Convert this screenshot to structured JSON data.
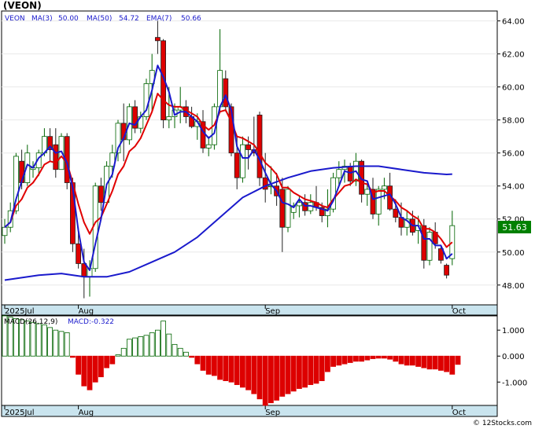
{
  "header": {
    "title": "(VEON)"
  },
  "legend": {
    "ticker": "VEON",
    "ma3": "MA(3)",
    "ma3_value": "50.00",
    "ma50": "MA(50)",
    "ma50_value": "54.72",
    "ema7": "EMA(7)",
    "ema7_value": "50.66"
  },
  "price_badge": "51.63",
  "macd_legend": {
    "label": "MACD(26,12,9)",
    "value": "MACD:-0.322"
  },
  "watermark": "© 12Stocks.com",
  "colors": {
    "up": "#006400",
    "down": "#dd0000",
    "ma3": "#1a1acc",
    "ma50": "#1a1acc",
    "ema7": "#e00000",
    "axis_band": "#c9e4ee",
    "badge": "#008000",
    "legend_text": "#1a1acc"
  },
  "chart_data": [
    {
      "type": "candlestick",
      "title": "",
      "x_labels": [
        "2025Jul",
        "Aug",
        "Sep",
        "Oct"
      ],
      "x_label_index": [
        0,
        13,
        46,
        79
      ],
      "y_ticks": [
        "48.00",
        "50.00",
        "52.00",
        "54.00",
        "56.00",
        "58.00",
        "60.00",
        "62.00",
        "64.00"
      ],
      "ylim": [
        46.8,
        64.6
      ],
      "candles": [
        [
          51.0,
          52.0,
          50.5,
          51.5
        ],
        [
          51.5,
          53.0,
          51.2,
          52.5
        ],
        [
          52.5,
          56.0,
          52.3,
          55.8
        ],
        [
          55.5,
          56.2,
          53.8,
          54.2
        ],
        [
          54.2,
          56.5,
          54.0,
          56.0
        ],
        [
          55.0,
          55.5,
          54.5,
          55.1
        ],
        [
          55.1,
          56.2,
          54.6,
          56.0
        ],
        [
          56.0,
          57.5,
          55.8,
          57.0
        ],
        [
          57.0,
          57.5,
          55.5,
          56.2
        ],
        [
          56.5,
          57.5,
          54.5,
          55.0
        ],
        [
          55.0,
          57.2,
          55.0,
          57.0
        ],
        [
          57.0,
          57.2,
          53.8,
          54.2
        ],
        [
          54.2,
          54.5,
          50.0,
          50.5
        ],
        [
          50.5,
          51.5,
          49.0,
          49.3
        ],
        [
          49.3,
          50.2,
          47.2,
          48.5
        ],
        [
          48.5,
          49.5,
          47.3,
          49.0
        ],
        [
          49.0,
          54.2,
          48.8,
          54.0
        ],
        [
          54.0,
          54.5,
          52.5,
          53.0
        ],
        [
          53.0,
          55.5,
          53.0,
          55.2
        ],
        [
          55.2,
          56.5,
          54.5,
          56.0
        ],
        [
          56.0,
          58.0,
          55.5,
          57.8
        ],
        [
          57.8,
          59.0,
          55.5,
          56.8
        ],
        [
          56.8,
          59.0,
          56.5,
          58.8
        ],
        [
          58.8,
          59.2,
          57.2,
          57.5
        ],
        [
          57.5,
          58.5,
          57.2,
          58.2
        ],
        [
          58.2,
          60.5,
          58.0,
          60.2
        ],
        [
          60.2,
          62.0,
          58.5,
          61.0
        ],
        [
          63.0,
          64.0,
          62.0,
          62.8
        ],
        [
          62.8,
          62.9,
          57.5,
          58.0
        ],
        [
          58.0,
          60.0,
          57.5,
          58.2
        ],
        [
          58.2,
          59.0,
          57.5,
          58.6
        ],
        [
          58.6,
          60.0,
          57.8,
          58.8
        ],
        [
          58.8,
          59.2,
          57.8,
          58.2
        ],
        [
          58.2,
          58.8,
          57.5,
          57.6
        ],
        [
          57.6,
          58.4,
          56.8,
          57.9
        ],
        [
          57.9,
          58.6,
          56.0,
          56.3
        ],
        [
          56.3,
          57.0,
          55.8,
          56.5
        ],
        [
          56.5,
          59.0,
          56.2,
          58.8
        ],
        [
          58.8,
          63.5,
          58.5,
          61.0
        ],
        [
          60.5,
          61.0,
          58.5,
          58.8
        ],
        [
          58.8,
          59.0,
          55.8,
          56.0
        ],
        [
          56.0,
          57.0,
          53.8,
          54.5
        ],
        [
          54.5,
          57.0,
          54.2,
          56.5
        ],
        [
          56.5,
          57.0,
          55.0,
          56.2
        ],
        [
          56.2,
          58.2,
          55.8,
          56.0
        ],
        [
          58.3,
          58.5,
          54.0,
          54.5
        ],
        [
          54.5,
          56.0,
          53.0,
          53.8
        ],
        [
          54.0,
          55.2,
          53.5,
          54.0
        ],
        [
          54.0,
          54.8,
          52.8,
          53.4
        ],
        [
          53.8,
          54.5,
          50.0,
          51.5
        ],
        [
          51.5,
          54.0,
          51.2,
          53.8
        ],
        [
          52.4,
          53.0,
          52.0,
          52.8
        ],
        [
          52.8,
          53.4,
          52.1,
          53.0
        ],
        [
          53.0,
          53.5,
          52.2,
          52.5
        ],
        [
          52.5,
          53.5,
          52.3,
          53.0
        ],
        [
          53.0,
          54.0,
          52.5,
          52.7
        ],
        [
          52.7,
          53.0,
          51.8,
          52.2
        ],
        [
          52.2,
          53.8,
          51.5,
          52.6
        ],
        [
          52.6,
          54.8,
          52.4,
          54.5
        ],
        [
          54.5,
          55.5,
          54.0,
          55.0
        ],
        [
          55.0,
          55.6,
          54.2,
          55.2
        ],
        [
          55.2,
          55.4,
          54.0,
          54.3
        ],
        [
          54.3,
          56.0,
          54.0,
          55.5
        ],
        [
          55.5,
          55.6,
          53.0,
          53.5
        ],
        [
          53.5,
          54.2,
          52.8,
          53.8
        ],
        [
          53.8,
          54.5,
          52.0,
          52.3
        ],
        [
          52.3,
          54.0,
          51.6,
          53.8
        ],
        [
          53.8,
          54.5,
          53.2,
          54.0
        ],
        [
          54.0,
          54.8,
          52.5,
          52.6
        ],
        [
          52.6,
          53.2,
          51.8,
          52.1
        ],
        [
          52.1,
          53.0,
          51.0,
          51.5
        ],
        [
          51.5,
          52.5,
          51.0,
          52.0
        ],
        [
          52.0,
          52.5,
          51.0,
          51.2
        ],
        [
          51.3,
          52.2,
          50.5,
          51.6
        ],
        [
          51.6,
          52.0,
          49.0,
          49.5
        ],
        [
          49.5,
          51.5,
          49.2,
          51.2
        ],
        [
          51.2,
          51.8,
          50.2,
          50.5
        ],
        [
          50.2,
          50.4,
          49.3,
          49.5
        ],
        [
          49.2,
          49.3,
          48.4,
          48.6
        ],
        [
          49.6,
          52.5,
          49.2,
          51.6
        ]
      ],
      "ma3": [
        51.5,
        51.8,
        53.2,
        54.3,
        55.3,
        55.1,
        55.7,
        56.0,
        56.4,
        56.0,
        56.1,
        55.4,
        53.9,
        51.3,
        49.4,
        48.9,
        50.5,
        52.0,
        54.1,
        54.7,
        56.3,
        56.9,
        57.8,
        57.7,
        58.2,
        58.6,
        59.8,
        61.3,
        60.6,
        59.7,
        58.3,
        58.5,
        58.5,
        58.2,
        57.9,
        57.3,
        56.9,
        57.2,
        58.8,
        59.5,
        58.6,
        56.4,
        55.7,
        55.7,
        56.2,
        55.6,
        54.8,
        54.1,
        53.7,
        53.0,
        52.9,
        52.7,
        53.2,
        52.8,
        52.8,
        52.7,
        52.6,
        52.5,
        53.1,
        54.0,
        54.9,
        54.8,
        54.9,
        54.4,
        54.3,
        53.2,
        53.3,
        53.4,
        53.5,
        52.9,
        52.1,
        51.9,
        51.6,
        51.6,
        50.8,
        50.8,
        50.4,
        50.4,
        49.6,
        49.9
      ],
      "ema7": [
        51.5,
        51.8,
        52.8,
        53.2,
        53.9,
        54.2,
        54.7,
        55.3,
        55.5,
        55.4,
        55.8,
        55.4,
        54.2,
        52.9,
        51.8,
        51.1,
        51.8,
        52.1,
        52.9,
        53.7,
        54.7,
        55.2,
        56.1,
        56.4,
        56.9,
        57.7,
        58.5,
        59.6,
        59.2,
        58.9,
        58.8,
        58.8,
        58.6,
        58.4,
        58.2,
        57.7,
        57.4,
        57.7,
        58.5,
        58.6,
        57.9,
        57.0,
        56.9,
        56.7,
        56.5,
        56.0,
        55.4,
        55.1,
        54.7,
        53.9,
        53.9,
        53.6,
        53.4,
        53.2,
        53.1,
        53.0,
        52.8,
        52.7,
        53.2,
        53.6,
        54.0,
        54.1,
        54.4,
        54.2,
        54.1,
        53.6,
        53.7,
        53.7,
        53.4,
        53.1,
        52.7,
        52.5,
        52.2,
        52.0,
        51.4,
        51.4,
        51.2,
        50.8,
        50.3,
        50.6
      ],
      "ma50_x": [
        0,
        6,
        10,
        14,
        18,
        22,
        26,
        30,
        34,
        38,
        42,
        46,
        50,
        54,
        58,
        62,
        66,
        70,
        74,
        78,
        79
      ],
      "ma50": [
        48.3,
        48.6,
        48.7,
        48.5,
        48.5,
        48.8,
        49.4,
        50.0,
        50.9,
        52.1,
        53.3,
        54.0,
        54.5,
        54.9,
        55.1,
        55.2,
        55.2,
        55.0,
        54.8,
        54.7,
        54.72
      ]
    },
    {
      "type": "bar",
      "title": "",
      "x_labels": [
        "2025Jul",
        "Aug",
        "Sep",
        "Oct"
      ],
      "x_label_index": [
        0,
        13,
        46,
        79
      ],
      "y_ticks": [
        "1.000",
        "0.000",
        "-1.000"
      ],
      "ylim": [
        -1.9,
        1.55
      ],
      "values": [
        1.55,
        1.5,
        1.45,
        1.4,
        1.35,
        1.3,
        1.25,
        1.2,
        1.1,
        1.0,
        0.95,
        0.9,
        -0.05,
        -0.7,
        -1.15,
        -1.3,
        -1.0,
        -0.8,
        -0.45,
        -0.3,
        0.05,
        0.3,
        0.65,
        0.7,
        0.75,
        0.8,
        0.9,
        1.0,
        1.35,
        0.85,
        0.45,
        0.3,
        0.15,
        -0.05,
        -0.3,
        -0.55,
        -0.7,
        -0.75,
        -0.9,
        -0.95,
        -1.0,
        -1.1,
        -1.2,
        -1.3,
        -1.45,
        -1.65,
        -1.9,
        -1.8,
        -1.7,
        -1.55,
        -1.45,
        -1.35,
        -1.25,
        -1.2,
        -1.1,
        -1.05,
        -0.95,
        -0.6,
        -0.4,
        -0.35,
        -0.3,
        -0.25,
        -0.2,
        -0.2,
        -0.15,
        -0.1,
        -0.08,
        -0.08,
        -0.12,
        -0.2,
        -0.3,
        -0.35,
        -0.35,
        -0.4,
        -0.45,
        -0.5,
        -0.5,
        -0.55,
        -0.6,
        -0.7,
        -0.32
      ]
    }
  ]
}
